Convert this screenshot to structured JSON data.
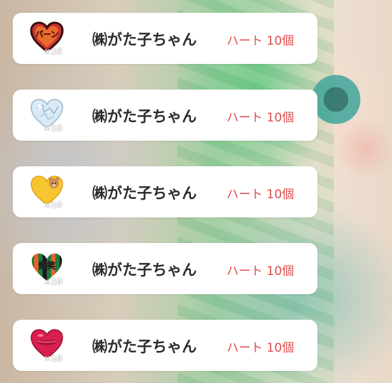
{
  "gifts": [
    {
      "sender": "㈱がた子ちゃん",
      "gift_label": "ハート 10個",
      "count": "×10",
      "sticker_icon": "burning-heart-icon",
      "sticker_text": "バーン"
    },
    {
      "sender": "㈱がた子ちゃん",
      "gift_label": "ハート 10個",
      "count": "×10",
      "sticker_icon": "ice-heart-icon",
      "sticker_text": ""
    },
    {
      "sender": "㈱がた子ちゃん",
      "gift_label": "ハート 10個",
      "count": "×10",
      "sticker_icon": "bear-heart-icon",
      "sticker_text": ""
    },
    {
      "sender": "㈱がた子ちゃん",
      "gift_label": "ハート 10個",
      "count": "×10",
      "sticker_icon": "lol-heart-icon",
      "sticker_text": "爆笑"
    },
    {
      "sender": "㈱がた子ちゃん",
      "gift_label": "ハート 10個",
      "count": "×10",
      "sticker_icon": "lips-heart-icon",
      "sticker_text": ""
    }
  ],
  "colors": {
    "gift_label": "#e14b4b",
    "sender": "#2b2b2b",
    "card": "#ffffff"
  }
}
